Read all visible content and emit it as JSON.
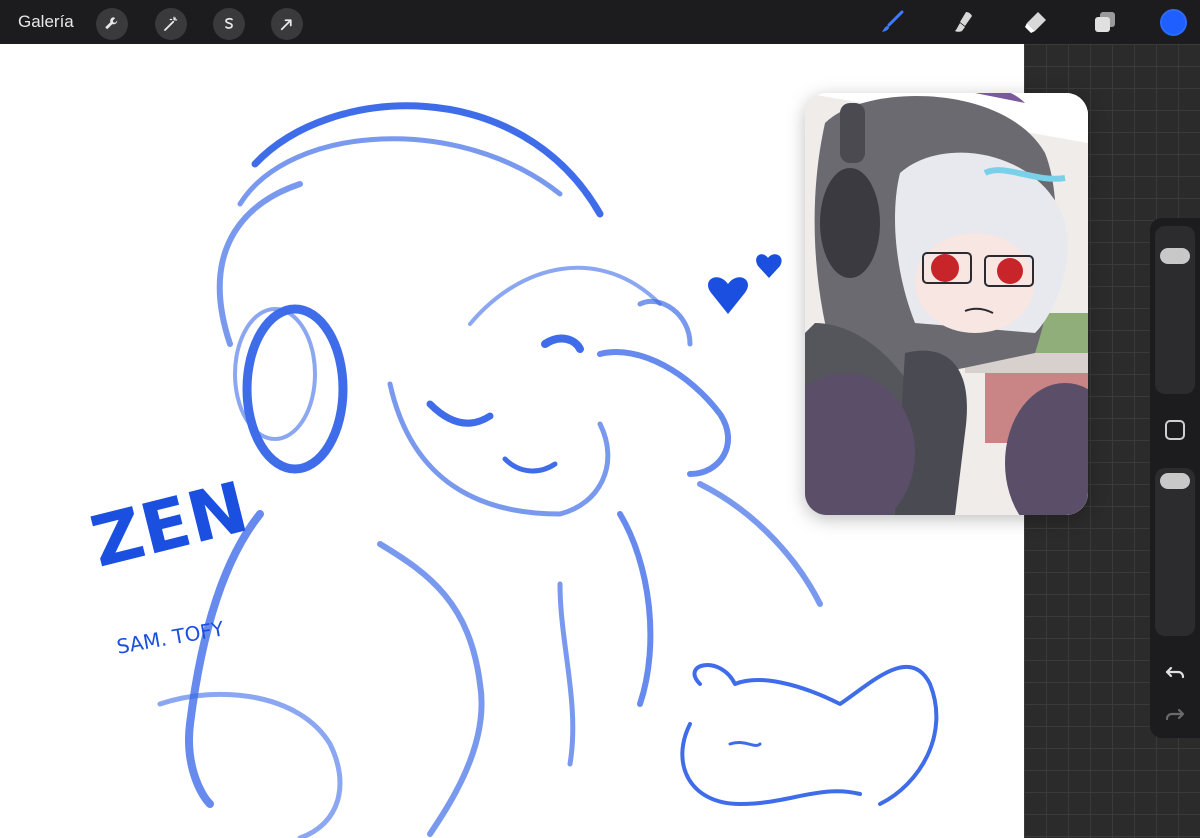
{
  "topbar": {
    "gallery_label": "Galería",
    "tools_left": [
      {
        "icon": "wrench-icon",
        "label": "Actions"
      },
      {
        "icon": "magic-wand-icon",
        "label": "Adjustments"
      },
      {
        "icon": "selection-s-icon",
        "label": "Selection"
      },
      {
        "icon": "arrow-cursor-icon",
        "label": "Transform"
      }
    ],
    "tools_right": [
      {
        "icon": "brush-icon",
        "active": true
      },
      {
        "icon": "smudge-icon",
        "active": false
      },
      {
        "icon": "eraser-icon",
        "active": false
      },
      {
        "icon": "layers-icon",
        "active": false
      }
    ],
    "current_color": "#1f5eff"
  },
  "canvas": {
    "sketch_color": "#1a4fe0",
    "sketch_text_zen": "ZEN",
    "signature_text": "SAM. TOFY"
  },
  "sidebar": {
    "size_slider_icon": "brush-size-slider",
    "modify_button_icon": "square-icon",
    "opacity_slider_icon": "opacity-slider",
    "undo_icon": "undo-icon",
    "redo_icon": "redo-icon"
  },
  "reference_window": {
    "icon": "reference-image"
  },
  "colors": {
    "toolbar_bg": "#1c1c1e",
    "accent": "#1f5eff"
  }
}
